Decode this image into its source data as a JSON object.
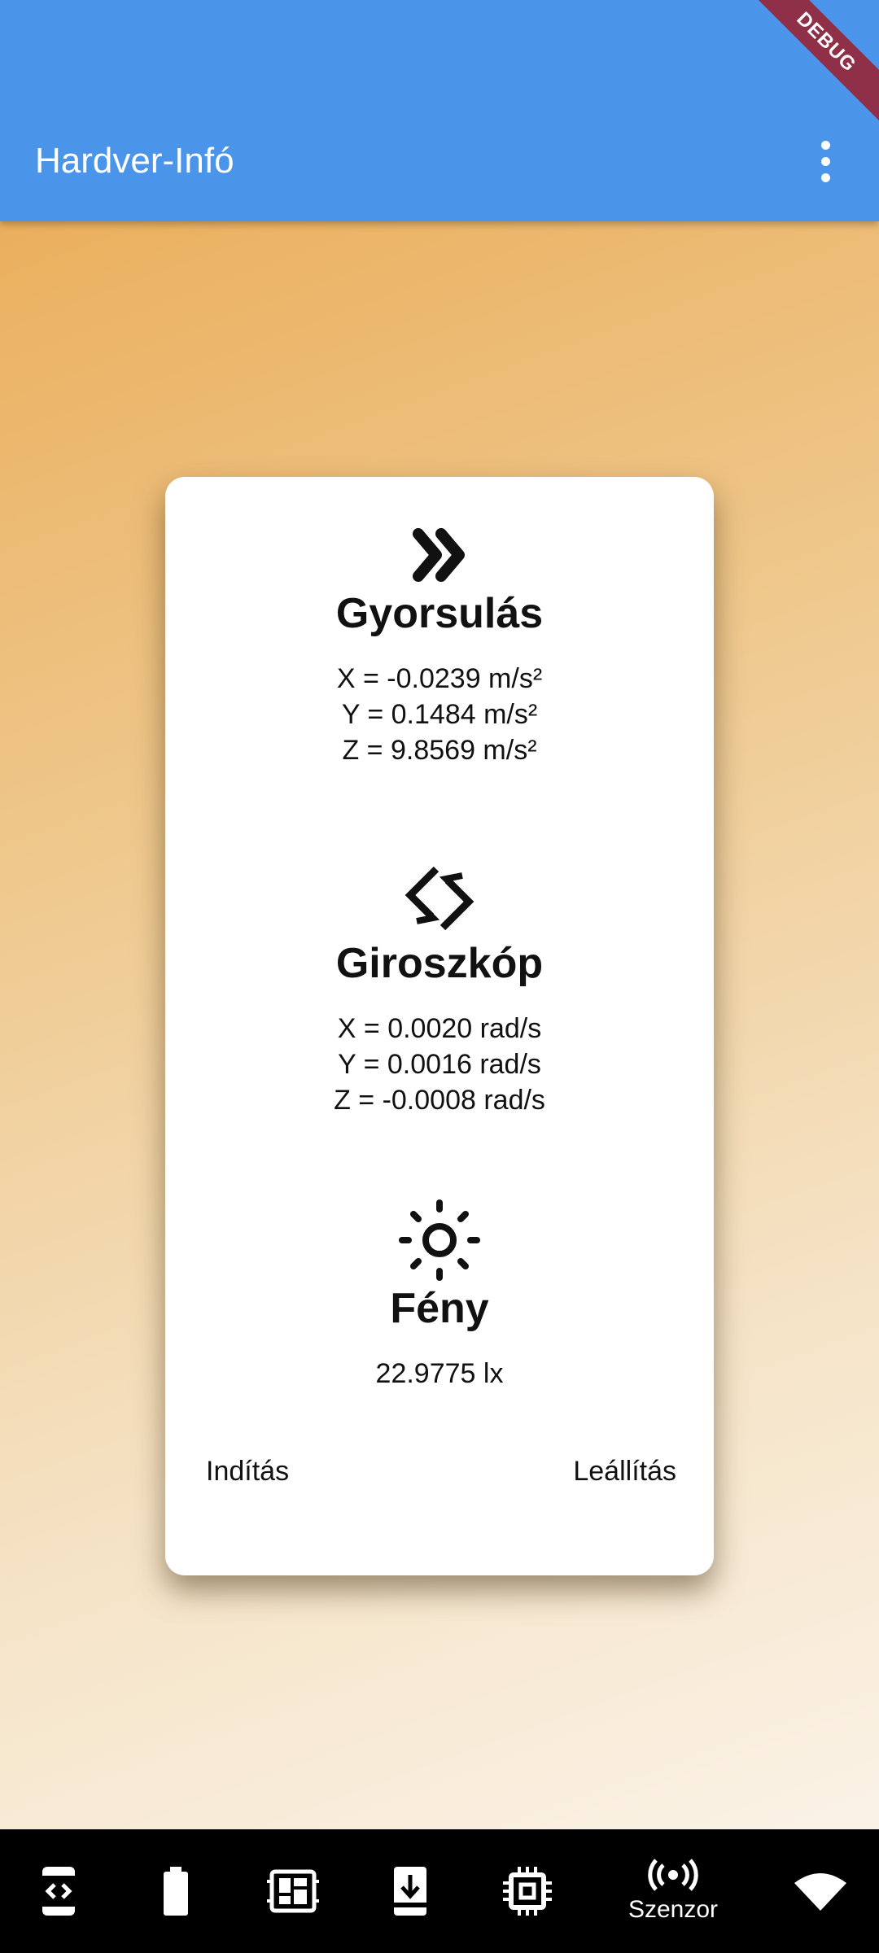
{
  "appbar": {
    "title": "Hardver-Infó",
    "more_icon": "more-vert-icon",
    "debug_banner": "DEBUG"
  },
  "card": {
    "acceleration": {
      "icon": "double-chevron-right-icon",
      "title": "Gyorsulás",
      "x": "X = -0.0239 m/s²",
      "y": "Y = 0.1484 m/s²",
      "z": "Z = 9.8569 m/s²"
    },
    "gyroscope": {
      "icon": "screen-rotation-icon",
      "title": "Giroszkóp",
      "x": "X = 0.0020 rad/s",
      "y": "Y = 0.0016 rad/s",
      "z": "Z = -0.0008 rad/s"
    },
    "light": {
      "icon": "brightness-icon",
      "title": "Fény",
      "value": "22.9775 lx"
    },
    "start_label": "Indítás",
    "stop_label": "Leállítás"
  },
  "bottom_nav": {
    "items": [
      {
        "icon": "device-code-icon"
      },
      {
        "icon": "battery-icon"
      },
      {
        "icon": "dashboard-icon"
      },
      {
        "icon": "download-icon"
      },
      {
        "icon": "memory-chip-icon"
      },
      {
        "icon": "sensor-broadcast-icon",
        "label": "Szenzor",
        "selected": true
      },
      {
        "icon": "wifi-icon"
      }
    ]
  },
  "colors": {
    "appbar": "#4a94ea",
    "debug": "#8f2f48",
    "card": "#ffffff",
    "navbar": "#000000"
  }
}
